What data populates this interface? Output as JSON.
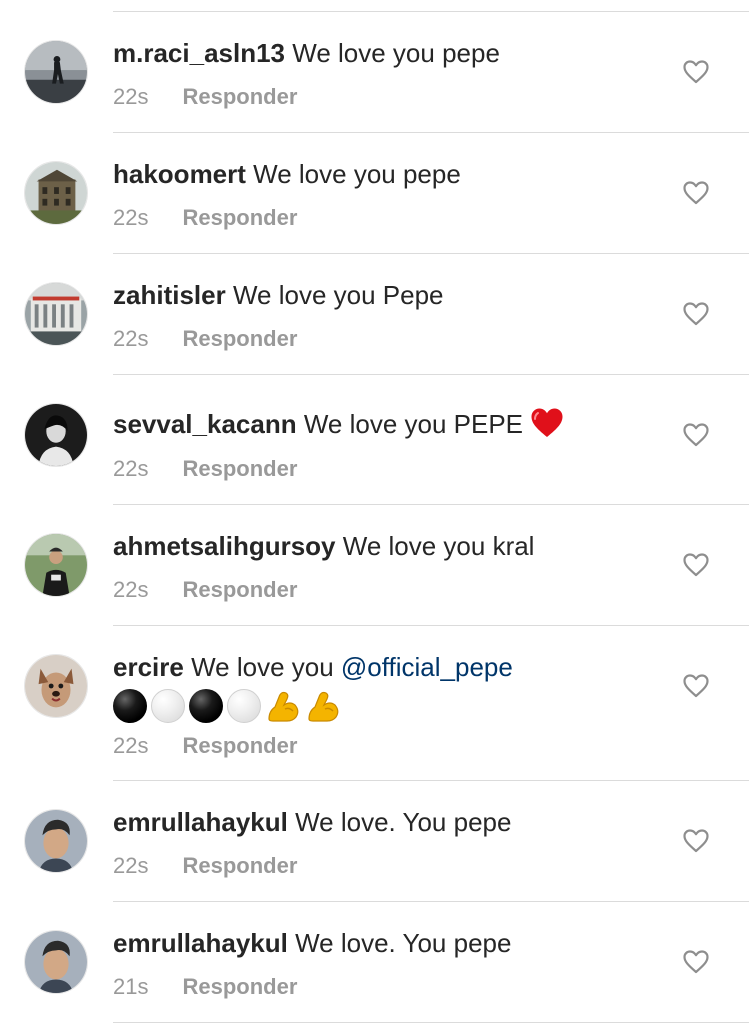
{
  "comments": [
    {
      "username": "m.raci_asln13",
      "text": "We love you pepe",
      "time": "22s",
      "reply": "Responder",
      "avatar": "person-silhouette-avatar"
    },
    {
      "username": "hakoomert",
      "text": "We love you pepe",
      "time": "22s",
      "reply": "Responder",
      "avatar": "building-avatar"
    },
    {
      "username": "zahitisler",
      "text": "We love you Pepe",
      "time": "22s",
      "reply": "Responder",
      "avatar": "building-facade-avatar"
    },
    {
      "username": "sevval_kacann",
      "text": "We love you PEPE",
      "emoji": "red-heart",
      "time": "22s",
      "reply": "Responder",
      "avatar": "portrait-bw-avatar"
    },
    {
      "username": "ahmetsalihgursoy",
      "text": "We love you kral",
      "time": "22s",
      "reply": "Responder",
      "avatar": "person-outdoors-avatar"
    },
    {
      "username": "ercire",
      "text": "We love you ",
      "mention": "@official_pepe",
      "emoji_line": [
        "black-circle",
        "white-circle",
        "black-circle",
        "white-circle",
        "flexed-biceps",
        "flexed-biceps"
      ],
      "time": "22s",
      "reply": "Responder",
      "avatar": "dog-filter-avatar"
    },
    {
      "username": "emrullahaykul",
      "text": "We love. You pepe",
      "time": "22s",
      "reply": "Responder",
      "avatar": "young-man-avatar"
    },
    {
      "username": "emrullahaykul",
      "text": "We love. You pepe",
      "time": "21s",
      "reply": "Responder",
      "avatar": "young-man-avatar"
    }
  ],
  "colors": {
    "username": "#262626",
    "meta": "#999999",
    "mention": "#003569",
    "divider": "#dbdbdb",
    "heart_outline": "#8e8e8e",
    "red_heart": "#e0101a"
  },
  "icons": {
    "like": "heart-outline-icon"
  }
}
